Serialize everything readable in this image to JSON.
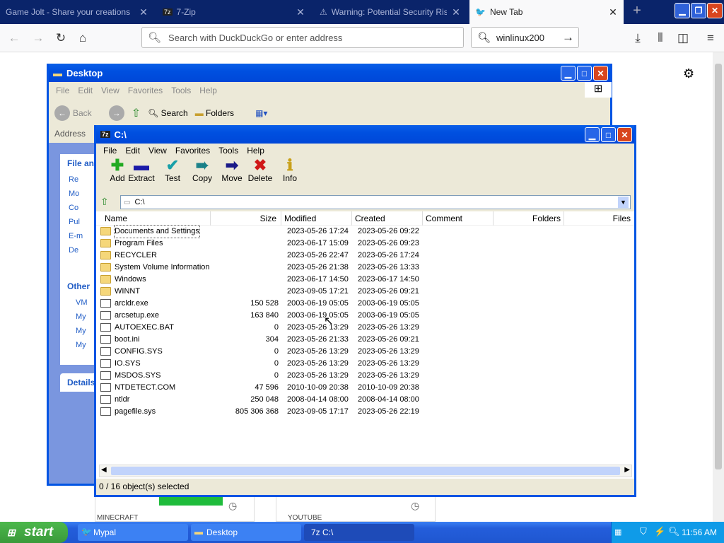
{
  "browser": {
    "tabs": [
      {
        "title": "Game Jolt - Share your creations"
      },
      {
        "title": "7-Zip"
      },
      {
        "title": "Warning: Potential Security Risk"
      },
      {
        "title": "New Tab"
      }
    ],
    "url_placeholder": "Search with DuckDuckGo or enter address",
    "search_value": "winlinux200"
  },
  "desktop_window": {
    "title": "Desktop",
    "menu": [
      "File",
      "Edit",
      "View",
      "Favorites",
      "Tools",
      "Help"
    ],
    "back_label": "Back",
    "search_label": "Search",
    "folders_label": "Folders",
    "address_label": "Address",
    "panel_file_title": "File an",
    "panel_file_items": [
      "Re",
      "Mo",
      "Co",
      "Pul",
      "E-m",
      "De"
    ],
    "panel_other_title": "Other",
    "panel_other_items": [
      "VM",
      "My",
      "My",
      "My"
    ],
    "panel_details_title": "Details"
  },
  "bg_tiles": [
    {
      "label": "MINECRAFT"
    },
    {
      "label": "YOUTUBE"
    }
  ],
  "sevenzip": {
    "title": "C:\\",
    "menu": [
      "File",
      "Edit",
      "View",
      "Favorites",
      "Tools",
      "Help"
    ],
    "toolbar": [
      {
        "label": "Add",
        "icon": "plus-icon",
        "color": "#22aa22"
      },
      {
        "label": "Extract",
        "icon": "minus-icon",
        "color": "#1a1aa8"
      },
      {
        "label": "Test",
        "icon": "check-icon",
        "color": "#18a0a8"
      },
      {
        "label": "Copy",
        "icon": "double-arrow-icon",
        "color": "#188088"
      },
      {
        "label": "Move",
        "icon": "arrow-right-icon",
        "color": "#1a1a88"
      },
      {
        "label": "Delete",
        "icon": "x-icon",
        "color": "#d01818"
      },
      {
        "label": "Info",
        "icon": "info-icon",
        "color": "#c8a018"
      }
    ],
    "path": "C:\\",
    "columns": [
      "Name",
      "Size",
      "Modified",
      "Created",
      "Comment",
      "Folders",
      "Files"
    ],
    "rows": [
      {
        "name": "Documents and Settings",
        "size": "",
        "modified": "2023-05-26 17:24",
        "created": "2023-05-26 09:22",
        "type": "folder"
      },
      {
        "name": "Program Files",
        "size": "",
        "modified": "2023-06-17 15:09",
        "created": "2023-05-26 09:23",
        "type": "folder"
      },
      {
        "name": "RECYCLER",
        "size": "",
        "modified": "2023-05-26 22:47",
        "created": "2023-05-26 17:24",
        "type": "folder"
      },
      {
        "name": "System Volume Information",
        "size": "",
        "modified": "2023-05-26 21:38",
        "created": "2023-05-26 13:33",
        "type": "folder"
      },
      {
        "name": "Windows",
        "size": "",
        "modified": "2023-06-17 14:50",
        "created": "2023-06-17 14:50",
        "type": "folder"
      },
      {
        "name": "WINNT",
        "size": "",
        "modified": "2023-09-05 17:21",
        "created": "2023-05-26 09:21",
        "type": "folder"
      },
      {
        "name": "arcldr.exe",
        "size": "150 528",
        "modified": "2003-06-19 05:05",
        "created": "2003-06-19 05:05",
        "type": "file"
      },
      {
        "name": "arcsetup.exe",
        "size": "163 840",
        "modified": "2003-06-19 05:05",
        "created": "2003-06-19 05:05",
        "type": "file"
      },
      {
        "name": "AUTOEXEC.BAT",
        "size": "0",
        "modified": "2023-05-26 13:29",
        "created": "2023-05-26 13:29",
        "type": "file"
      },
      {
        "name": "boot.ini",
        "size": "304",
        "modified": "2023-05-26 21:33",
        "created": "2023-05-26 09:21",
        "type": "file"
      },
      {
        "name": "CONFIG.SYS",
        "size": "0",
        "modified": "2023-05-26 13:29",
        "created": "2023-05-26 13:29",
        "type": "file"
      },
      {
        "name": "IO.SYS",
        "size": "0",
        "modified": "2023-05-26 13:29",
        "created": "2023-05-26 13:29",
        "type": "file"
      },
      {
        "name": "MSDOS.SYS",
        "size": "0",
        "modified": "2023-05-26 13:29",
        "created": "2023-05-26 13:29",
        "type": "file"
      },
      {
        "name": "NTDETECT.COM",
        "size": "47 596",
        "modified": "2010-10-09 20:38",
        "created": "2010-10-09 20:38",
        "type": "file"
      },
      {
        "name": "ntldr",
        "size": "250 048",
        "modified": "2008-04-14 08:00",
        "created": "2008-04-14 08:00",
        "type": "file"
      },
      {
        "name": "pagefile.sys",
        "size": "805 306 368",
        "modified": "2023-09-05 17:17",
        "created": "2023-05-26 22:19",
        "type": "file"
      }
    ],
    "status": "0 / 16 object(s) selected"
  },
  "taskbar": {
    "start_label": "start",
    "tasks": [
      {
        "label": "Mypal"
      },
      {
        "label": "Desktop"
      },
      {
        "label": "7z C:\\"
      }
    ],
    "clock": "11:56 AM"
  }
}
